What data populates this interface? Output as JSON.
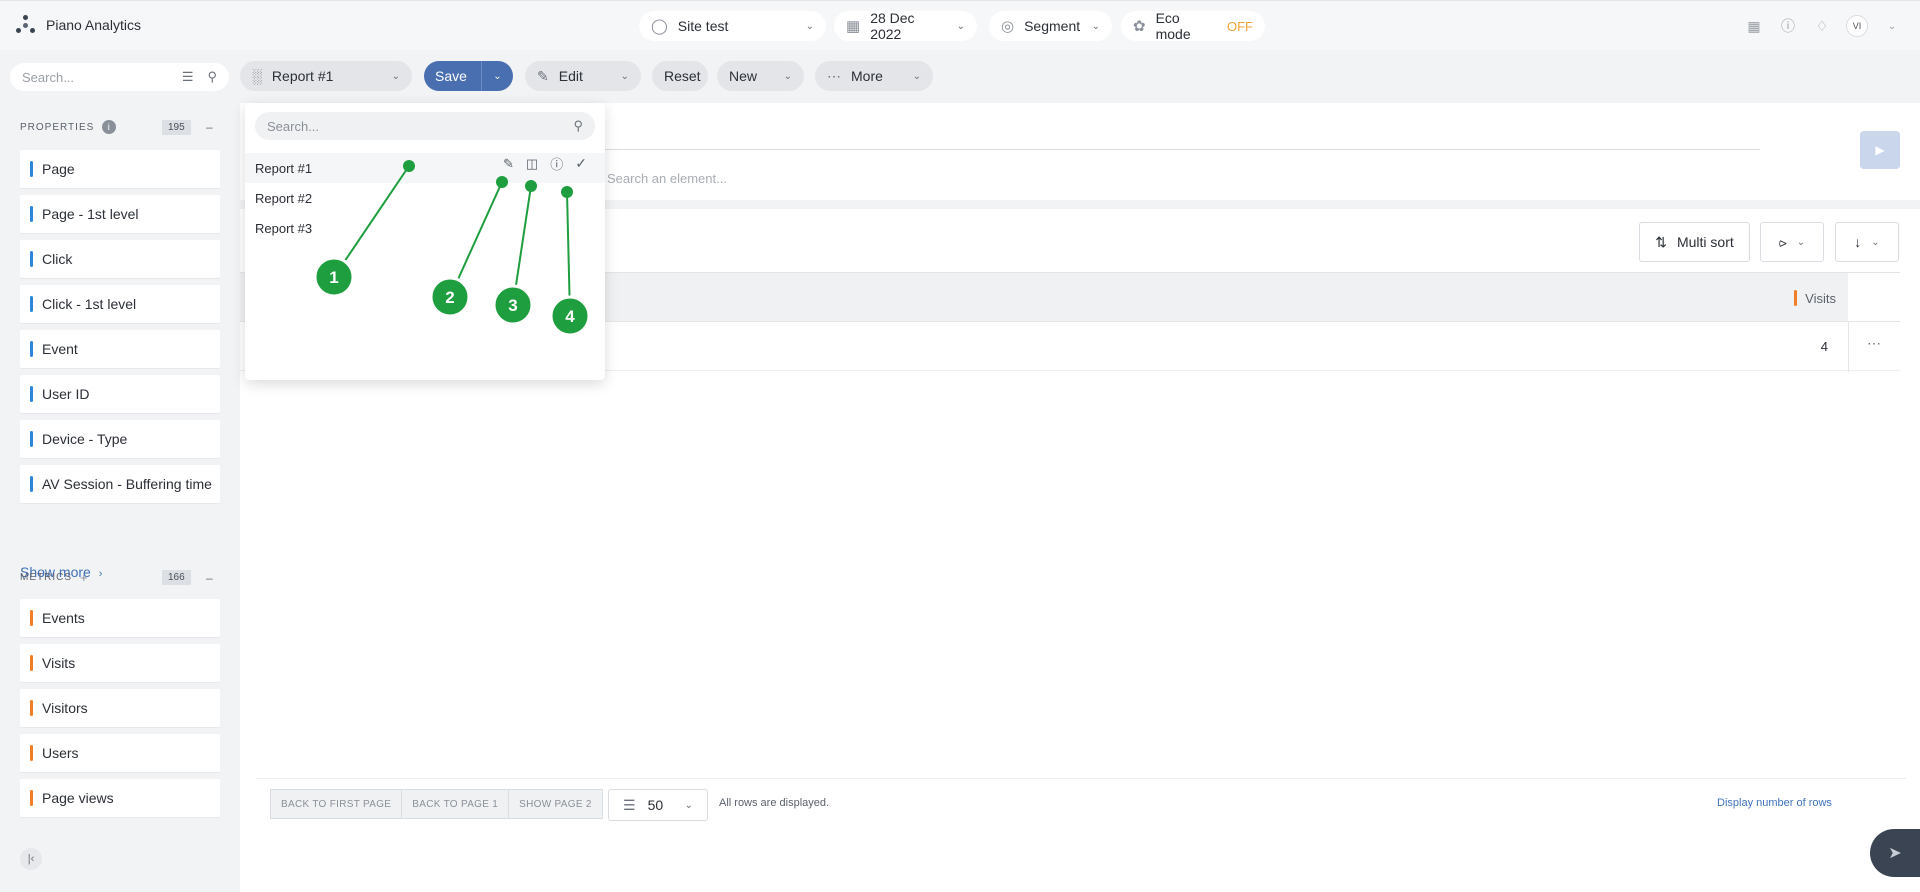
{
  "app": {
    "name": "Piano Analytics"
  },
  "topbar": {
    "site": "Site test",
    "date": "28 Dec 2022",
    "segment": "Segment",
    "eco_mode": "Eco mode",
    "eco_state": "OFF",
    "avatar": "VI"
  },
  "toolbar": {
    "report": "Report #1",
    "save": "Save",
    "edit": "Edit",
    "reset": "Reset",
    "new": "New",
    "more": "More"
  },
  "sidebar": {
    "search_placeholder": "Search...",
    "properties": {
      "title": "PROPERTIES",
      "count": "195",
      "items": [
        "Page",
        "Page - 1st level",
        "Click",
        "Click - 1st level",
        "Event",
        "User ID",
        "Device - Type",
        "AV Session - Buffering time"
      ]
    },
    "show_more": "Show more",
    "metrics": {
      "title": "METRICS",
      "count": "166",
      "items": [
        "Events",
        "Visits",
        "Visitors",
        "Users",
        "Page views"
      ]
    }
  },
  "query": {
    "search_placeholder": "Search an element..."
  },
  "table_toolbar": {
    "multi_sort": "Multi sort"
  },
  "table": {
    "column": "Visits",
    "rows": [
      {
        "visits": "4"
      }
    ]
  },
  "footer": {
    "pager": [
      "BACK TO FIRST PAGE",
      "BACK TO PAGE 1",
      "SHOW PAGE 2"
    ],
    "rows_value": "50",
    "all_rows": "All rows are displayed.",
    "display_rows": "Display number of rows"
  },
  "dropdown": {
    "search_placeholder": "Search...",
    "items": [
      "Report #1",
      "Report #2",
      "Report #3"
    ],
    "selected": "Report #1"
  },
  "annotations": [
    "1",
    "2",
    "3",
    "4"
  ],
  "colors": {
    "property_accent": "#2f86d9",
    "metric_accent": "#f07e26",
    "save_button": "#4a6fb0",
    "annotation": "#1e9e3e",
    "eco_off": "#f2a33a"
  },
  "icons": [
    "logo-icon",
    "globe-icon",
    "calendar-icon",
    "segment-icon",
    "leaf-icon",
    "grid-icon",
    "help-icon",
    "bell-icon",
    "chart-icon",
    "pencil-icon",
    "ellipsis-icon",
    "search-icon",
    "filter-icon",
    "info-icon",
    "trash-icon",
    "check-icon",
    "play-icon",
    "sort-icon",
    "share-icon",
    "download-icon",
    "list-icon",
    "rocket-icon"
  ]
}
